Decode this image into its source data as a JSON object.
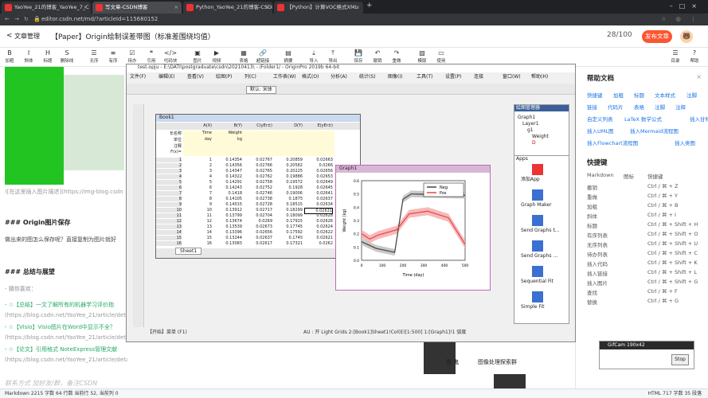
{
  "tabs": [
    {
      "label": "YaoYee_21的博客_YaoYee_7_C"
    },
    {
      "label": "写文章-CSDN博客"
    },
    {
      "label": "Python_YaoYee_21的博客-CSDN"
    },
    {
      "label": "【Python】计算VOC格式XML"
    }
  ],
  "url": "editor.csdn.net/md/?articleId=115680152",
  "editor": {
    "back": "文章管理",
    "title": "【Paper】Origin绘制误差带图（标准差围绕均值）",
    "count": "28/100",
    "publish": "发布文章",
    "avatar": "🐻"
  },
  "toolbar": [
    "加粗",
    "斜体",
    "标题",
    "删除线",
    "无序",
    "有序",
    "待办",
    "引用",
    "代码块",
    "图片",
    "视频",
    "表格",
    "超链接",
    "摘要",
    "导入",
    "导出",
    "保存",
    "撤销",
    "重做",
    "模版",
    "使用",
    "目录",
    "帮助"
  ],
  "left": {
    "lines": [
      "![在这里插入图片描述](https://img-blog.csdn",
      "### Origin图片保存",
      "做出来的图怎么保存呢？直接复制为图片就好",
      "### 总结与展望",
      "- 猜你喜欢：",
      "- ☆【总结】一文了解所有的机器学习评价指",
      "(https://blog.csdn.net/YaoYee_21/article/detail",
      "- ☆【Visio】Visio图片在Word中显示不全？",
      "(https://blog.csdn.net/YaoYee_21/article/detail",
      "- ☆【论文】引用格式 NoteExpress管理文献",
      "(https://blog.csdn.net/YaoYee_21/article/details/114604937)"
    ],
    "footer_signature": "联系方式 加好友/群，备注CSDN",
    "qr1_label": "醒 鬼",
    "qr2_label": "图像处理探索群"
  },
  "right": {
    "help_title": "帮助文档",
    "help_links": [
      [
        "快捷键",
        "加粗",
        "标题",
        "文本样式",
        "注脚"
      ],
      [
        "链接",
        "代码片",
        "表格",
        "注脚",
        "注释"
      ],
      [
        "自定义列表",
        "LaTeX 数学公式",
        "插入甘特图"
      ],
      [
        "插入UML图",
        "插入Mermaid流程图"
      ],
      [
        "插入Flowchart流程图",
        "插入类图"
      ]
    ],
    "shortcut_title": "快捷键",
    "shortcut_header": [
      "Markdown",
      "图标",
      "快捷键"
    ],
    "shortcuts": [
      [
        "撤销",
        "Ctrl / ⌘ + Z"
      ],
      [
        "重做",
        "Ctrl / ⌘ + Y"
      ],
      [
        "加粗",
        "Ctrl / ⌘ + B"
      ],
      [
        "斜体",
        "Ctrl / ⌘ + I"
      ],
      [
        "标题",
        "Ctrl / ⌘ + Shift + H"
      ],
      [
        "有序列表",
        "Ctrl / ⌘ + Shift + O"
      ],
      [
        "无序列表",
        "Ctrl / ⌘ + Shift + U"
      ],
      [
        "待办列表",
        "Ctrl / ⌘ + Shift + C"
      ],
      [
        "插入代码",
        "Ctrl / ⌘ + Shift + K"
      ],
      [
        "插入链接",
        "Ctrl / ⌘ + Shift + L"
      ],
      [
        "插入图片",
        "Ctrl / ⌘ + Shift + G"
      ],
      [
        "查找",
        "Ctrl / ⌘ + F"
      ],
      [
        "替换",
        "Ctrl / ⌘ + G"
      ]
    ]
  },
  "origin": {
    "title": "test.opju - E:\\DATI\\postgraduate\\csdn\\20210413\\ - /Folder1/ - OriginPro 2019b 64-bit",
    "menus": [
      "文件(F)",
      "编辑(E)",
      "查看(V)",
      "绘图(P)",
      "列(C)",
      "工作表(W)",
      "格式(O)",
      "分析(A)",
      "统计(S)",
      "图像(I)",
      "工具(T)",
      "设置(P)",
      "连接",
      "窗口(W)",
      "帮助(H)"
    ],
    "font": "默认: 宋体",
    "book_title": "Book1",
    "graph_title": "Graph1",
    "sheet_tab": "Sheet1",
    "col_headers": [
      "A(X)",
      "B(Y)",
      "C(yEr±)",
      "D(Y)",
      "E(yEr±)"
    ],
    "row_labels": [
      "长名称",
      "单位",
      "注释",
      "F(x)="
    ],
    "long_names": [
      "Time",
      "Weight",
      "",
      "",
      ""
    ],
    "units": [
      "day",
      "kg",
      "",
      "",
      ""
    ],
    "rows": [
      [
        "1",
        "0.14354",
        "0.02767",
        "0.20859",
        "0.02663"
      ],
      [
        "2",
        "0.14356",
        "0.02766",
        "0.20582",
        "0.0266"
      ],
      [
        "3",
        "0.14347",
        "0.02765",
        "0.20225",
        "0.02656"
      ],
      [
        "4",
        "0.14322",
        "0.02762",
        "0.19886",
        "0.02653"
      ],
      [
        "5",
        "0.14291",
        "0.02758",
        "0.19572",
        "0.02649"
      ],
      [
        "6",
        "0.14243",
        "0.02752",
        "0.1928",
        "0.02645"
      ],
      [
        "7",
        "0.1418",
        "0.02746",
        "0.19006",
        "0.02641"
      ],
      [
        "8",
        "0.14105",
        "0.02738",
        "0.1875",
        "0.02637"
      ],
      [
        "9",
        "0.14015",
        "0.02728",
        "0.18515",
        "0.02634"
      ],
      [
        "10",
        "0.13912",
        "0.02717",
        "0.18299",
        "0.02631"
      ],
      [
        "11",
        "0.13799",
        "0.02704",
        "0.18099",
        "0.02628"
      ],
      [
        "12",
        "0.13674",
        "0.0269",
        "0.17915",
        "0.02626"
      ],
      [
        "13",
        "0.13539",
        "0.02673",
        "0.17745",
        "0.02624"
      ],
      [
        "14",
        "0.13396",
        "0.02656",
        "0.17592",
        "0.02622"
      ],
      [
        "15",
        "0.13244",
        "0.02637",
        "0.1745",
        "0.02621"
      ],
      [
        "16",
        "0.13083",
        "0.02617",
        "0.17321",
        "0.0262"
      ]
    ],
    "legend": [
      "Neg",
      "Pos"
    ],
    "x_ticks": [
      "0",
      "100",
      "200",
      "300",
      "400",
      "500"
    ],
    "y_ticks": [
      "0.0",
      "0.1",
      "0.2",
      "0.3",
      "0.4",
      "0.5",
      "0.6"
    ],
    "xlabel": "Time (day)",
    "ylabel": "Weight (kg)",
    "project_panel": "绘图管理器",
    "tree": [
      "Graph1",
      "Layer1",
      "g1",
      "Weight",
      "D"
    ],
    "apps_title": "Apps",
    "apps": [
      "添加App",
      "Graph Maker",
      "Send Graphs t...",
      "Send Graphs ...",
      "Sequential Fit",
      "Simple Fit"
    ],
    "statusbar": "AU : 开  Light Grids  2:[Book1]Sheet1!Col(E)[1:500]  1:[Graph1]!1  弧度",
    "start": "【开始】菜单 (F1)"
  },
  "gifcam": {
    "title": "GifCam 190x42",
    "button": "Stop"
  },
  "status": {
    "left": "Markdown  2215 字数  64 行数  当前行 52, 当前列 0",
    "right": "HTML  717 字数  35 段落"
  }
}
